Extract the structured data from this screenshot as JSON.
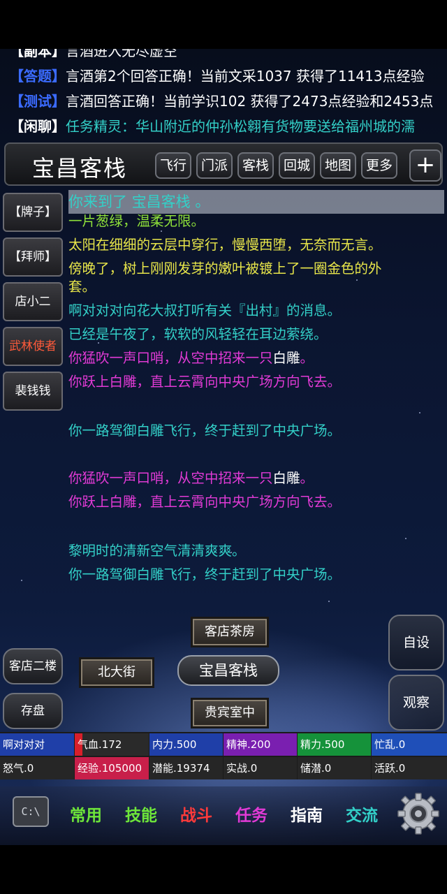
{
  "chat": [
    {
      "tag": "【副本】",
      "tag_color": "#ffffff",
      "text": "言酒进入无尽虚空"
    },
    {
      "tag": "【答题】",
      "tag_color": "#3b6bff",
      "text": "言酒第2个回答正确！当前文采1037 获得了11413点经验"
    },
    {
      "tag": "【测试】",
      "tag_color": "#3b6bff",
      "text": "言酒回答正确！当前学识102 获得了2473点经验和2453点"
    },
    {
      "tag": "【闲聊】",
      "tag_color": "#ffffff",
      "text": "任务精灵：华山附近的仲孙松翱有货物要送给福州城的濡",
      "text_color": "#33d0c8"
    }
  ],
  "location": {
    "title": "宝昌客栈",
    "nav": [
      "飞行",
      "门派",
      "客栈",
      "回城",
      "地图",
      "更多"
    ],
    "plus": "+"
  },
  "npcs": [
    {
      "label": "【牌子】",
      "special": false
    },
    {
      "label": "【拜师】",
      "special": false
    },
    {
      "label": "店小二",
      "special": false
    },
    {
      "label": "武林使者",
      "special": true
    },
    {
      "label": "裴钱钱",
      "special": false
    }
  ],
  "log": {
    "arrive_prefix": "你来到了",
    "arrive_place": "宝昌客栈",
    "arrive_suffix": "。",
    "lines": [
      {
        "text": "一片葱绿，温柔无限。",
        "color": "#8fe13a"
      },
      {
        "text": "太阳在细细的云层中穿行，慢慢西堕，无奈而无言。",
        "color": "#e8e64a"
      },
      {
        "text": "傍晚了，树上刚刚发芽的嫩叶被镀上了一圈金色的外",
        "color": "#e8e64a"
      },
      {
        "text": "套。",
        "color": "#e8e64a"
      },
      {
        "text": "啊对对对向花大叔打听有关『出村』的消息。",
        "color": "#33d0c8"
      },
      {
        "text": "已经是午夜了，软软的风轻轻在耳边萦绕。",
        "color": "#33d0c8"
      },
      {
        "text": "你猛吹一声口哨，从空中招来一只",
        "color": "#e23ad6",
        "suffix": "白雕",
        "suffix_suffix": "。"
      },
      {
        "text": "你跃上白雕，直上云霄向中央广场方向飞去。",
        "color": "#e23ad6"
      },
      {
        "text": "你一路驾御白雕飞行，终于赶到了中央广场。",
        "color": "#33d0c8"
      },
      {
        "text": "你猛吹一声口哨，从空中招来一只",
        "color": "#e23ad6",
        "suffix": "白雕",
        "suffix_suffix": "。"
      },
      {
        "text": "你跃上白雕，直上云霄向中央广场方向飞去。",
        "color": "#e23ad6"
      },
      {
        "text": "黎明时的清新空气清清爽爽。",
        "color": "#33d0c8"
      },
      {
        "text": "你一路驾御白雕飞行，终于赶到了中央广场。",
        "color": "#33d0c8"
      }
    ]
  },
  "map": {
    "north": "客店茶房",
    "west": "北大街",
    "center": "宝昌客栈",
    "south": "贵宾室中",
    "up": "客店二楼",
    "save": "存盘",
    "self_check": "自设",
    "observe": "观察"
  },
  "stats": {
    "name": "啊对对对",
    "hp": "气血.172",
    "neili": "内力.500",
    "jingshen": "精神.200",
    "jingli": "精力.500",
    "busy": "忙乱.0",
    "rage": "怒气.0",
    "exp": "经验.105000",
    "potential": "潜能.19374",
    "combat": "实战.0",
    "stored": "储潜.0",
    "active": "活跃.0"
  },
  "tabs": [
    {
      "label": "常用",
      "color": "#6ee63a"
    },
    {
      "label": "技能",
      "color": "#6ee63a"
    },
    {
      "label": "战斗",
      "color": "#ff3a3a"
    },
    {
      "label": "任务",
      "color": "#e23ad6"
    },
    {
      "label": "指南",
      "color": "#ffffff"
    },
    {
      "label": "交流",
      "color": "#33d0c8"
    }
  ],
  "icons": {
    "terminal": "terminal-icon",
    "terminal_text": "C:\\",
    "settings": "gear-icon"
  }
}
